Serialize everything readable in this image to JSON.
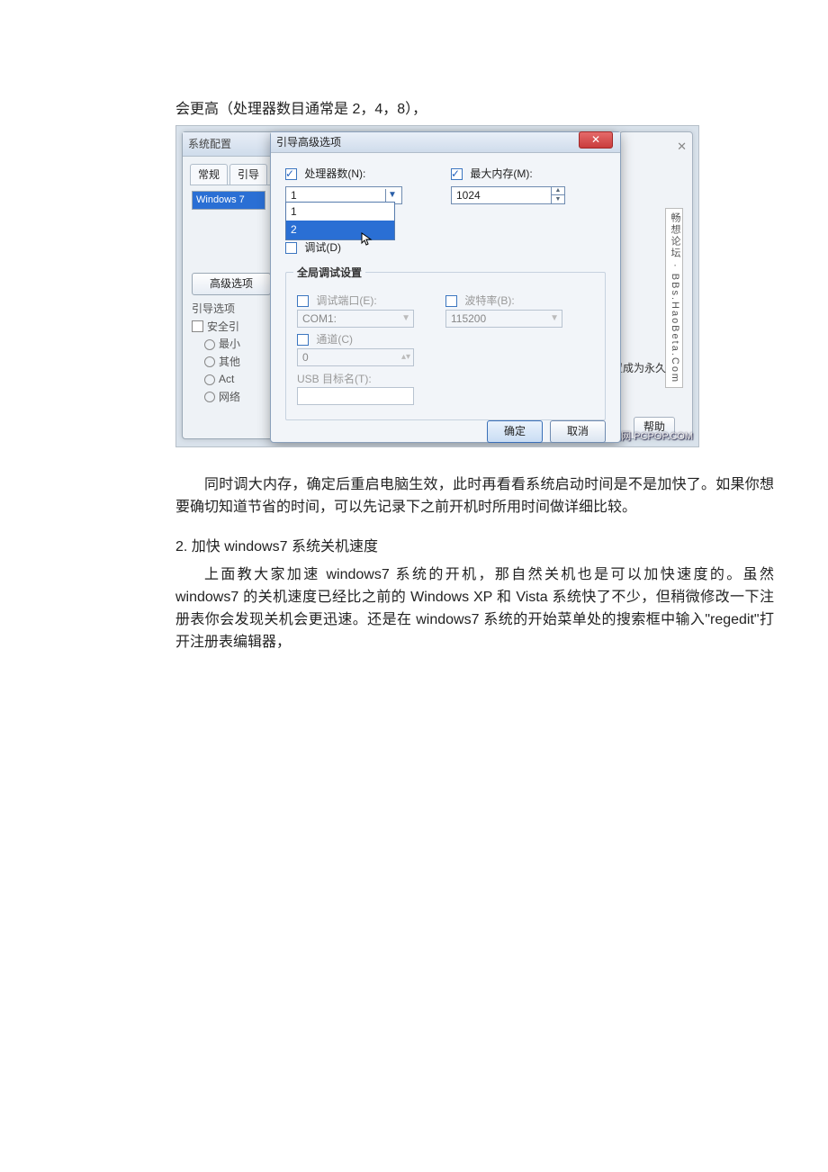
{
  "intro_top": "会更高（处理器数目通常是 2，4，8），",
  "back": {
    "title_fragment": "系统配置",
    "tab_general": "常规",
    "tab_boot": "引导",
    "list_sel": "Windows 7",
    "btn_adv": "高级选项",
    "sec_boot_opt": "引导选项",
    "chk_safe": "安全引",
    "r_min": "最小",
    "r_other": "其他",
    "r_act": "Act",
    "r_net": "网络"
  },
  "dlg": {
    "title": "引导高级选项",
    "proc_label": "处理器数(N):",
    "proc_value": "1",
    "dd_opt1": "1",
    "dd_opt2": "2",
    "mem_label": "最大内存(M):",
    "mem_value": "1024",
    "chk_debug": "调试(D)",
    "group_title": "全局调试设置",
    "port_label": "调试端口(E):",
    "port_value": "COM1:",
    "baud_label": "波特率(B):",
    "baud_value": "115200",
    "chan_label": "通道(C)",
    "chan_value": "0",
    "usb_label": "USB 目标名(T):",
    "ok": "确定",
    "cancel": "取消"
  },
  "right": {
    "x": "✕",
    "watermark": "畅想论坛 · BBs.HaoBeta.Com",
    "snippet": "设置成为永久",
    "help": "帮助",
    "footer": "泡泡网  PCPOP.COM"
  },
  "para1": "同时调大内存，确定后重启电脑生效，此时再看看系统启动时间是不是加快了。如果你想要确切知道节省的时间，可以先记录下之前开机时所用时间做详细比较。",
  "sec2_head": "2.  加快 windows7 系统关机速度",
  "para2": "上面教大家加速 windows7 系统的开机，那自然关机也是可以加快速度的。虽然 windows7 的关机速度已经比之前的 Windows XP 和 Vista 系统快了不少，但稍微修改一下注册表你会发现关机会更迅速。还是在 windows7 系统的开始菜单处的搜索框中输入\"regedit\"打开注册表编辑器，"
}
